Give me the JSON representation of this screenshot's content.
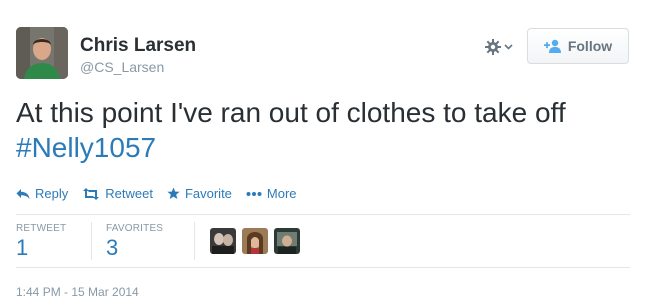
{
  "author": {
    "name": "Chris Larsen",
    "handle": "@CS_Larsen"
  },
  "header": {
    "follow_label": "Follow"
  },
  "tweet": {
    "text": "At this point I've ran out of clothes to take off",
    "hashtag": "#Nelly1057"
  },
  "actions": [
    {
      "label": "Reply",
      "icon": "reply-icon"
    },
    {
      "label": "Retweet",
      "icon": "retweet-icon"
    },
    {
      "label": "Favorite",
      "icon": "star-icon"
    },
    {
      "label": "More",
      "icon": "more-dots-icon"
    }
  ],
  "stats": {
    "retweets_label": "RETWEET",
    "retweets_value": "1",
    "favorites_label": "FAVORITES",
    "favorites_value": "3"
  },
  "timestamp": "1:44 PM - 15 Mar 2014",
  "colors": {
    "link": "#2b7bb9",
    "muted": "#8899a6",
    "text": "#292f33"
  }
}
